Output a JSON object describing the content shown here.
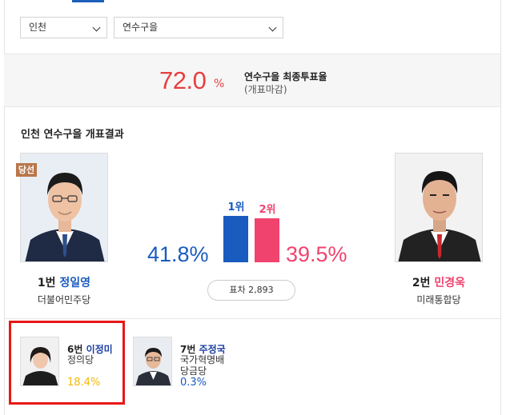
{
  "filters": {
    "region": "인천",
    "district": "연수구을"
  },
  "turnout": {
    "value": "72.0",
    "unit": "%",
    "title": "연수구을 최종투표율",
    "status": "(개표마감)"
  },
  "result_title": "인천 연수구을 개표결과",
  "winner_badge": "당선",
  "leaders": [
    {
      "number": "1번",
      "name": "정일영",
      "party": "더불어민주당",
      "rank": "1위",
      "percent": "41.8%",
      "color": "#1a5bbf",
      "bar_ratio": 1.0
    },
    {
      "number": "2번",
      "name": "민경욱",
      "party": "미래통합당",
      "rank": "2위",
      "percent": "39.5%",
      "color": "#f0436e",
      "bar_ratio": 0.945
    }
  ],
  "difference": "표차 2,893",
  "others": [
    {
      "number": "6번",
      "name": "이정미",
      "party": "정의당",
      "percent": "18.4%",
      "color": "#f5b800"
    },
    {
      "number": "7번",
      "name": "주정국",
      "party": "국가혁명배당금당",
      "party_line1": "국가혁명배",
      "party_line2": "당금당",
      "percent": "0.3%",
      "color": "#1a5bbf"
    }
  ]
}
